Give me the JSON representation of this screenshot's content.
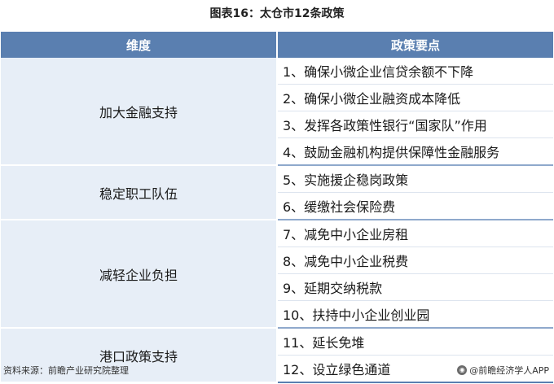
{
  "title": "图表16：太仓市12条政策",
  "table": {
    "headers": [
      "维度",
      "政策要点"
    ],
    "groups": [
      {
        "category": "加大金融支持",
        "items": [
          "1、确保小微企业信贷余额不下降",
          "2、确保小微企业融资成本降低",
          "3、发挥各政策性银行“国家队”作用",
          "4、鼓励金融机构提供保障性金融服务"
        ]
      },
      {
        "category": "稳定职工队伍",
        "items": [
          "5、实施援企稳岗政策",
          "6、缓缴社会保险费"
        ]
      },
      {
        "category": "减轻企业负担",
        "items": [
          "7、减免中小企业房租",
          "8、减免中小企业税费",
          "9、延期交纳税款",
          "10、扶持中小企业创业园"
        ]
      },
      {
        "category": "港口政策支持",
        "items": [
          "11、延长免堆",
          "12、设立绿色通道"
        ]
      }
    ]
  },
  "footer": {
    "source": "资料来源：前瞻产业研究院整理",
    "brand": "@前瞻经济学人APP",
    "brand_icon": "brand-logo-icon"
  }
}
